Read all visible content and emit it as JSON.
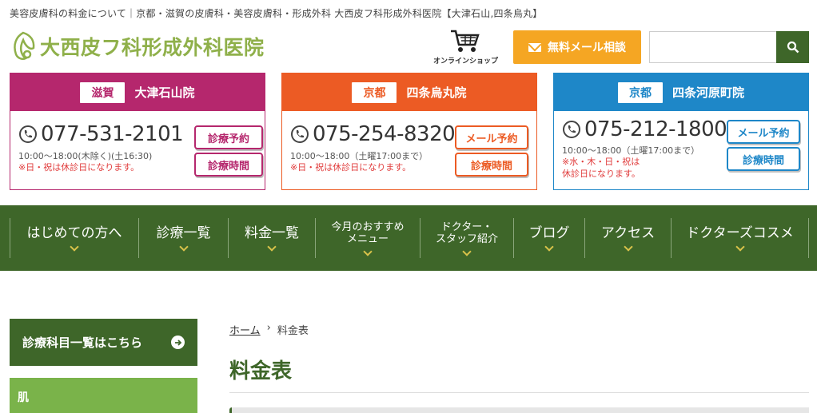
{
  "header": {
    "tagline": "美容皮膚科の料金について｜京都・滋賀の皮膚科・美容皮膚科・形成外科 大西皮フ科形成外科医院【大津石山,四条烏丸】",
    "logo_text": "大西皮フ科形成外科医院",
    "shop_label": "オンラインショップ",
    "mail_label": "無料メール相談",
    "search_placeholder": ""
  },
  "clinics": [
    {
      "region": "滋賀",
      "name": "大津石山院",
      "phone": "077-531-2101",
      "hours": "10:00〜18:00(木除く)(土16:30)",
      "note": "※日・祝は休診日になります。",
      "btn1": "診療予約",
      "btn2": "診療時間",
      "color": "#b5276d"
    },
    {
      "region": "京都",
      "name": "四条烏丸院",
      "phone": "075-254-8320",
      "hours": "10:00〜18:00（土曜17:00まで）",
      "note": "※日・祝は休診日になります。",
      "btn1": "メール予約",
      "btn2": "診療時間",
      "color": "#ec5b24"
    },
    {
      "region": "京都",
      "name": "四条河原町院",
      "phone": "075-212-1800",
      "hours": "10:00〜18:00（土曜17:00まで）",
      "note": "※水・木・日・祝は\n休診日になります。",
      "btn1": "メール予約",
      "btn2": "診療時間",
      "color": "#1e87c8"
    }
  ],
  "nav": [
    {
      "label": "はじめての方へ"
    },
    {
      "label": "診療一覧"
    },
    {
      "label": "料金一覧"
    },
    {
      "label": "今月のおすすめ\nメニュー"
    },
    {
      "label": "ドクター・\nスタッフ紹介"
    },
    {
      "label": "ブログ"
    },
    {
      "label": "アクセス"
    },
    {
      "label": "ドクターズコスメ"
    }
  ],
  "sidebar": {
    "head": "診療科目一覧はこちら",
    "item": "肌"
  },
  "breadcrumb": {
    "home": "ホーム",
    "sep": "›",
    "current": "料金表"
  },
  "page_title": "料金表",
  "colors": {
    "brand_green": "#3e6629",
    "accent_orange": "#f5a623",
    "light_green": "#7ab34a"
  }
}
